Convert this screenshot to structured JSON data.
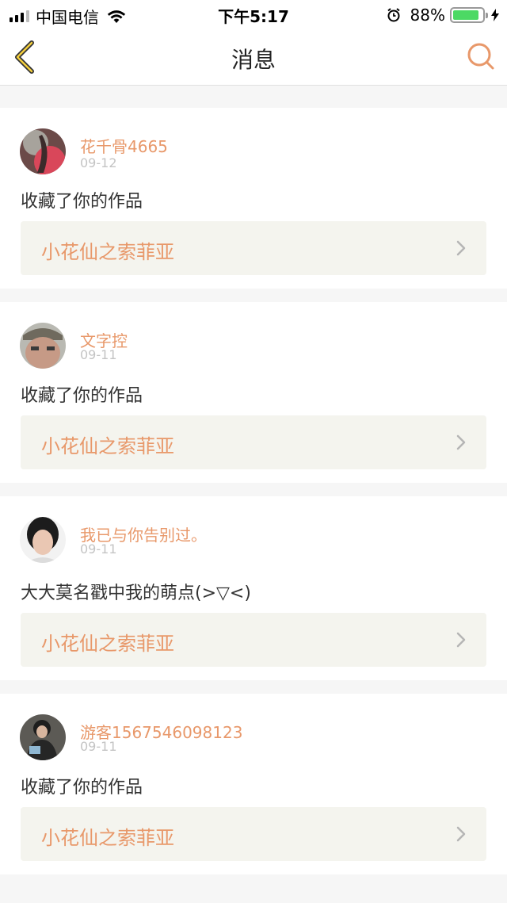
{
  "status_bar": {
    "carrier": "中国电信",
    "time": "下午5:17",
    "battery_percent": "88%",
    "battery_level": 0.88,
    "signal_bars_filled": 3,
    "signal_bars_total": 4
  },
  "nav": {
    "title": "消息",
    "back_icon": "chevron-left-icon",
    "search_icon": "search-icon",
    "accent_color": "#e8986a"
  },
  "messages": [
    {
      "username": "花千骨4665",
      "date": "09-12",
      "action": "收藏了你的作品",
      "work_title": "小花仙之索菲亚"
    },
    {
      "username": "文字控",
      "date": "09-11",
      "action": "收藏了你的作品",
      "work_title": "小花仙之索菲亚"
    },
    {
      "username": "我已与你告别过。",
      "date": "09-11",
      "action": "大大莫名戳中我的萌点(>▽<)",
      "work_title": "小花仙之索菲亚"
    },
    {
      "username": "游客1567546098123",
      "date": "09-11",
      "action": "收藏了你的作品",
      "work_title": "小花仙之索菲亚"
    }
  ]
}
